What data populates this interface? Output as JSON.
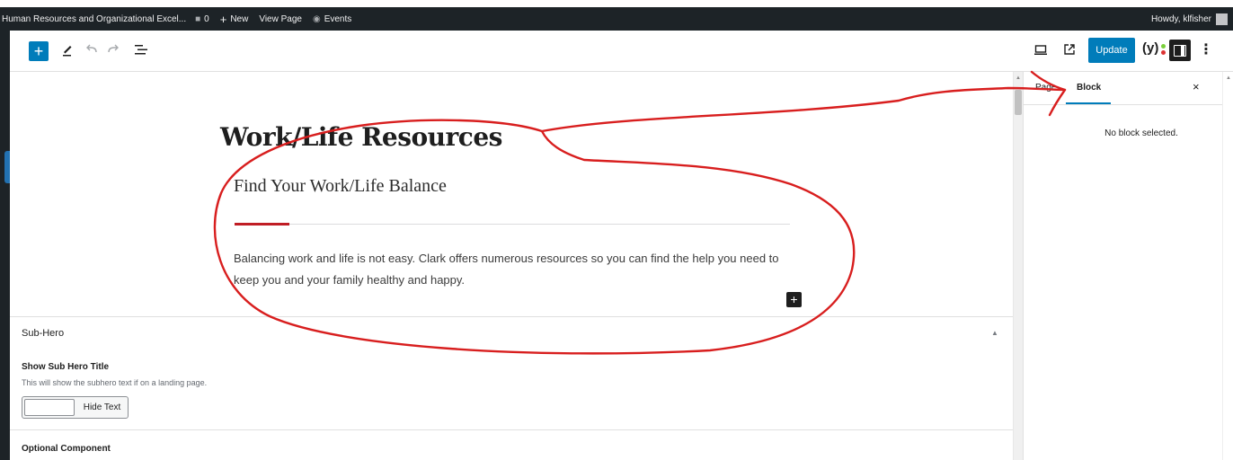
{
  "admin_bar": {
    "site_name": "Human Resources and Organizational Excel...",
    "comments_count": "0",
    "new_label": "New",
    "view_page_label": "View Page",
    "events_label": "Events",
    "howdy": "Howdy, klfisher"
  },
  "header": {
    "inserter_icon": "+",
    "update_label": "Update",
    "yoast_label": "(y)",
    "options_icon": "⋮"
  },
  "content": {
    "title": "Work/Life Resources",
    "subtitle": "Find Your Work/Life Balance",
    "intro": "Balancing work and life is not easy. Clark offers numerous resources so you can find the help you need to keep you and your family healthy and happy.",
    "add_block_icon": "+"
  },
  "meta_box": {
    "panel_title": "Sub-Hero",
    "field_label": "Show Sub Hero Title",
    "field_description": "This will show the subhero text if on a landing page.",
    "toggle_label": "Hide Text",
    "optional_component": "Optional Component"
  },
  "sidebar": {
    "tab_page": "Page",
    "tab_block": "Block",
    "close_icon": "×",
    "empty_message": "No block selected."
  },
  "colors": {
    "admin_bar_bg": "#1d2327",
    "accent_blue": "#007cba",
    "brand_red": "#c01d24",
    "annotation_red": "#d81e1e"
  }
}
